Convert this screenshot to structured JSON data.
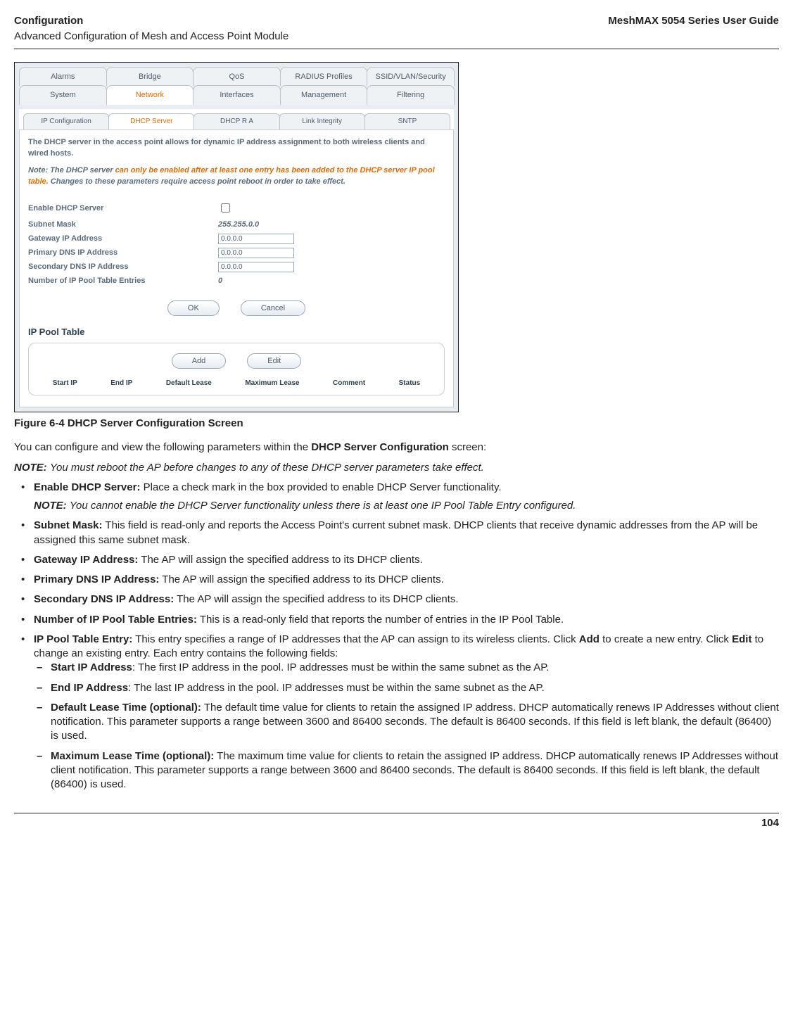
{
  "header": {
    "left": "Configuration",
    "right": "MeshMAX 5054 Series User Guide",
    "sub": "Advanced Configuration of Mesh and Access Point Module"
  },
  "screenshot": {
    "tabs_top": [
      "Alarms",
      "Bridge",
      "QoS",
      "RADIUS Profiles",
      "SSID/VLAN/Security"
    ],
    "tabs_bottom": [
      "System",
      "Network",
      "Interfaces",
      "Management",
      "Filtering"
    ],
    "active_main": "Network",
    "subtabs": [
      "IP Configuration",
      "DHCP Server",
      "DHCP R A",
      "Link Integrity",
      "SNTP"
    ],
    "active_sub": "DHCP Server",
    "desc": "The DHCP server in the access point allows for dynamic IP address assignment to both wireless clients and wired hosts.",
    "warn_prefix": "Note: The DHCP server",
    "warn_hot": " can only be enabled after at least one entry has been added to the DHCP server IP pool table.",
    "warn_suffix": " Changes to these parameters require access point reboot in order to take effect.",
    "fields": {
      "enable_label": "Enable DHCP Server",
      "subnet_label": "Subnet Mask",
      "subnet_value": "255.255.0.0",
      "gateway_label": "Gateway IP Address",
      "gateway_value": "0.0.0.0",
      "pdns_label": "Primary DNS IP Address",
      "pdns_value": "0.0.0.0",
      "sdns_label": "Secondary DNS IP Address",
      "sdns_value": "0.0.0.0",
      "entries_label": "Number of IP Pool Table Entries",
      "entries_value": "0"
    },
    "buttons": {
      "ok": "OK",
      "cancel": "Cancel",
      "add": "Add",
      "edit": "Edit"
    },
    "pool_title": "IP Pool Table",
    "pool_cols": [
      "Start IP",
      "End IP",
      "Default Lease",
      "Maximum Lease",
      "Comment",
      "Status"
    ]
  },
  "caption": "Figure 6-4 DHCP Server Configuration Screen",
  "body": {
    "intro_pre": "You can configure and view the following parameters within the ",
    "intro_bold": "DHCP Server Configuration",
    "intro_post": " screen:",
    "note1_label": "NOTE:",
    "note1_text": "You must reboot the AP before changes to any of these DHCP server parameters take effect.",
    "bullets": {
      "enable_b": "Enable DHCP Server:",
      "enable_t": " Place a check mark in the box provided to enable DHCP Server functionality.",
      "enable_note_label": "NOTE:",
      "enable_note_text": "You cannot enable the DHCP Server functionality unless there is at least one IP Pool Table Entry configured.",
      "subnet_b": "Subnet Mask:",
      "subnet_t": " This field is read-only and reports the Access Point's current subnet mask. DHCP clients that receive dynamic addresses from the AP will be assigned this same subnet mask.",
      "gateway_b": "Gateway IP Address:",
      "gateway_t": " The AP will assign the specified address to its DHCP clients.",
      "pdns_b": "Primary DNS IP Address:",
      "pdns_t": " The AP will assign the specified address to its DHCP clients.",
      "sdns_b": "Secondary DNS IP Address:",
      "sdns_t": " The AP will assign the specified address to its DHCP clients.",
      "num_b": "Number of IP Pool Table Entries:",
      "num_t": " This is a read-only field that reports the number of entries in the IP Pool Table.",
      "pool_b": "IP Pool Table Entry:",
      "pool_t1": " This entry specifies a range of IP addresses that the AP can assign to its wireless clients. Click ",
      "pool_add": "Add",
      "pool_t2": " to create a new entry. Click ",
      "pool_edit": "Edit",
      "pool_t3": " to change an existing entry. Each entry contains the following fields:"
    },
    "dashes": {
      "start_b": "Start IP Address",
      "start_t": ": The first IP address in the pool. IP addresses must be within the same subnet as the AP.",
      "end_b": "End IP Address",
      "end_t": ": The last IP address in the pool. IP addresses must be within the same subnet as the AP.",
      "dlease_b": "Default Lease Time (optional):",
      "dlease_t": " The default time value for clients to retain the assigned IP address. DHCP automatically renews IP Addresses without client notification. This parameter supports a range between 3600 and 86400 seconds. The default is 86400 seconds. If this field is left blank, the default (86400) is used.",
      "mlease_b": "Maximum Lease Time (optional):",
      "mlease_t": " The maximum time value for clients to retain the assigned IP address. DHCP automatically renews IP Addresses without client notification. This parameter supports a range between 3600 and 86400 seconds. The default is 86400 seconds. If this field is left blank, the default (86400) is used."
    }
  },
  "page_number": "104"
}
